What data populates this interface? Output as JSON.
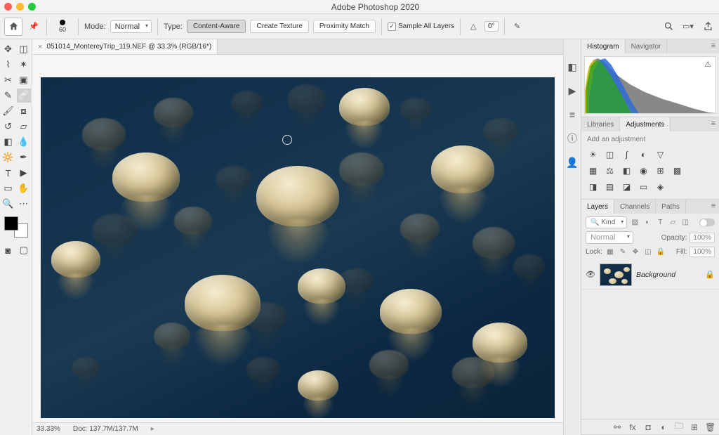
{
  "app": {
    "title": "Adobe Photoshop 2020"
  },
  "options_bar": {
    "brush_size": "60",
    "mode_label": "Mode:",
    "mode_value": "Normal",
    "type_label": "Type:",
    "btn_content_aware": "Content-Aware",
    "btn_create_texture": "Create Texture",
    "btn_proximity": "Proximity Match",
    "sample_all_label": "Sample All Layers",
    "angle_icon": "△",
    "angle_value": "0°"
  },
  "document": {
    "tab_title": "051014_MontereyTrip_119.NEF @ 33.3% (RGB/16*)",
    "zoom": "33.33%",
    "doc_info": "Doc: 137.7M/137.7M"
  },
  "right_panels": {
    "histogram_tabs": {
      "histogram": "Histogram",
      "navigator": "Navigator"
    },
    "libraries_tabs": {
      "libraries": "Libraries",
      "adjustments": "Adjustments"
    },
    "adjustments_hint": "Add an adjustment",
    "layers_tabs": {
      "layers": "Layers",
      "channels": "Channels",
      "paths": "Paths"
    },
    "kind_label": "Kind",
    "blend_mode": "Normal",
    "opacity_label": "Opacity:",
    "opacity_value": "100%",
    "lock_label": "Lock:",
    "fill_label": "Fill:",
    "fill_value": "100%",
    "layer0_name": "Background"
  }
}
